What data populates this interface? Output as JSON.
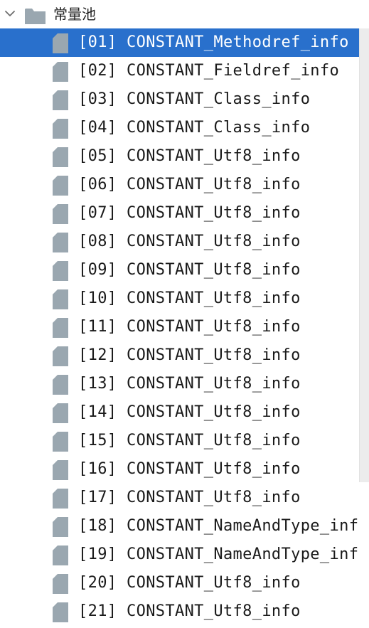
{
  "tree": {
    "group": {
      "label": "常量池",
      "expanded": true,
      "chevron_icon": "chevron-down-icon",
      "folder_icon": "folder-icon"
    },
    "selected_index": 0,
    "items": [
      {
        "index": "[01]",
        "name": "CONSTANT_Methodref_info"
      },
      {
        "index": "[02]",
        "name": "CONSTANT_Fieldref_info"
      },
      {
        "index": "[03]",
        "name": "CONSTANT_Class_info"
      },
      {
        "index": "[04]",
        "name": "CONSTANT_Class_info"
      },
      {
        "index": "[05]",
        "name": "CONSTANT_Utf8_info"
      },
      {
        "index": "[06]",
        "name": "CONSTANT_Utf8_info"
      },
      {
        "index": "[07]",
        "name": "CONSTANT_Utf8_info"
      },
      {
        "index": "[08]",
        "name": "CONSTANT_Utf8_info"
      },
      {
        "index": "[09]",
        "name": "CONSTANT_Utf8_info"
      },
      {
        "index": "[10]",
        "name": "CONSTANT_Utf8_info"
      },
      {
        "index": "[11]",
        "name": "CONSTANT_Utf8_info"
      },
      {
        "index": "[12]",
        "name": "CONSTANT_Utf8_info"
      },
      {
        "index": "[13]",
        "name": "CONSTANT_Utf8_info"
      },
      {
        "index": "[14]",
        "name": "CONSTANT_Utf8_info"
      },
      {
        "index": "[15]",
        "name": "CONSTANT_Utf8_info"
      },
      {
        "index": "[16]",
        "name": "CONSTANT_Utf8_info"
      },
      {
        "index": "[17]",
        "name": "CONSTANT_Utf8_info"
      },
      {
        "index": "[18]",
        "name": "CONSTANT_NameAndType_info"
      },
      {
        "index": "[19]",
        "name": "CONSTANT_NameAndType_info"
      },
      {
        "index": "[20]",
        "name": "CONSTANT_Utf8_info"
      },
      {
        "index": "[21]",
        "name": "CONSTANT_Utf8_info"
      }
    ],
    "item_icon": "file-icon"
  },
  "colors": {
    "selection": "#2970cc",
    "icon_gray": "#9aa7b0",
    "text": "#1a1a1a",
    "selected_text": "#ffffff"
  }
}
